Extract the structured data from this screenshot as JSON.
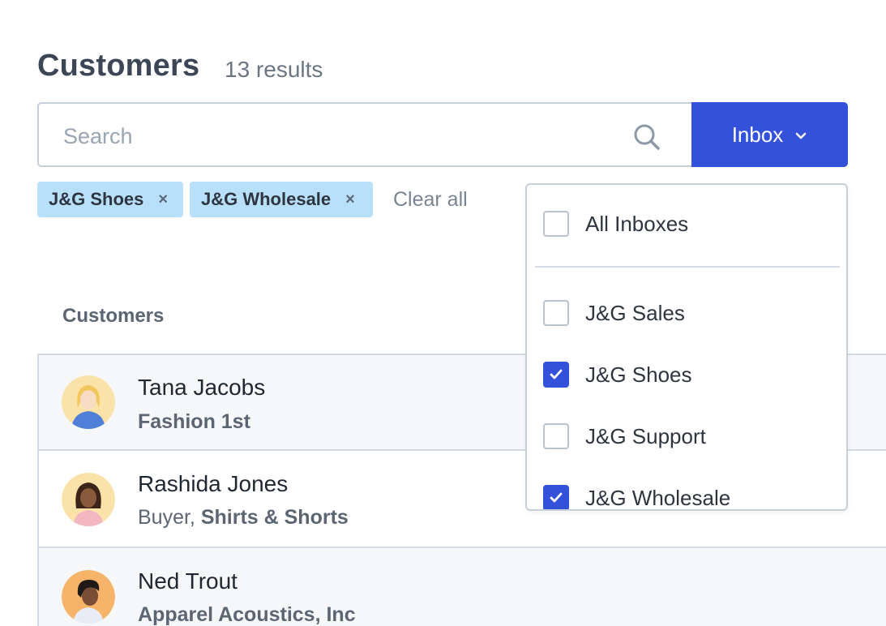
{
  "header": {
    "title": "Customers",
    "results": "13 results"
  },
  "search": {
    "placeholder": "Search",
    "value": ""
  },
  "inbox_button": {
    "label": "Inbox"
  },
  "filters": {
    "chips": [
      {
        "label": "J&G Shoes",
        "remove": "×"
      },
      {
        "label": "J&G Wholesale",
        "remove": "×"
      }
    ],
    "clear_all": "Clear all"
  },
  "list": {
    "header": "Customers",
    "customers": [
      {
        "name": "Tana Jacobs",
        "role": "",
        "company": "Fashion 1st"
      },
      {
        "name": "Rashida Jones",
        "role": "Buyer, ",
        "company": "Shirts & Shorts"
      },
      {
        "name": "Ned Trout",
        "role": "",
        "company": "Apparel Acoustics, Inc"
      }
    ]
  },
  "dropdown": {
    "all_inboxes": {
      "label": "All Inboxes",
      "checked": false
    },
    "options": [
      {
        "label": "J&G Sales",
        "checked": false
      },
      {
        "label": "J&G Shoes",
        "checked": true
      },
      {
        "label": "J&G Support",
        "checked": false
      },
      {
        "label": "J&G Wholesale",
        "checked": true
      }
    ]
  },
  "colors": {
    "accent": "#3352d9",
    "chip": "#b8e0fa",
    "border": "#c7cfd9"
  }
}
